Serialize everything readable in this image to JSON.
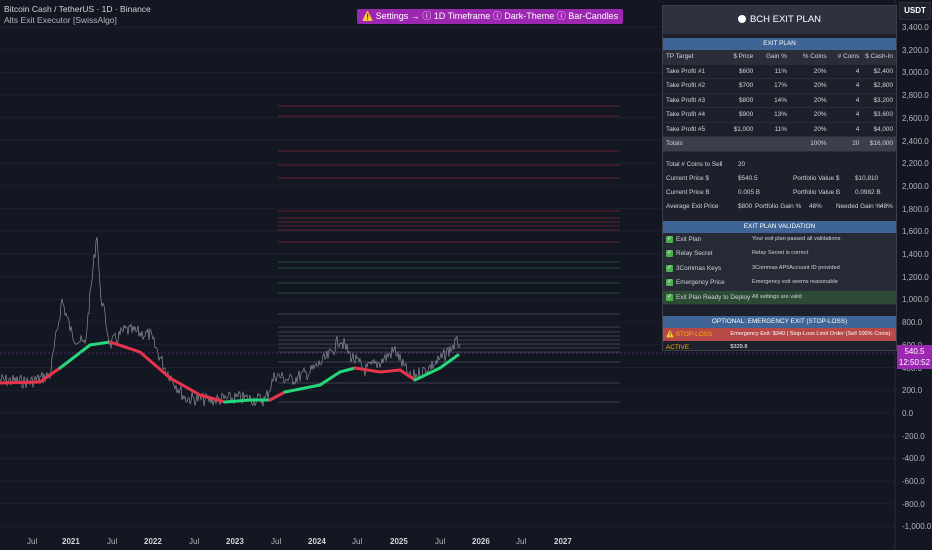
{
  "header": {
    "symbol_line": "Bitcoin Cash / TetherUS · 1D · Binance",
    "indicator_line": "Alts Exit Executor [SwissAlgo]",
    "banner": "⚠️ Settings → ⓘ 1D Timeframe ⓘ Dark-Theme ⓘ Bar-Candles",
    "currency_button": "USDT"
  },
  "price_axis": {
    "labels": [
      "3,400.0",
      "3,200.0",
      "3,000.0",
      "2,800.0",
      "2,600.0",
      "2,400.0",
      "2,200.0",
      "2,000.0",
      "1,800.0",
      "1,600.0",
      "1,400.0",
      "1,200.0",
      "1,000.0",
      "800.0",
      "600.0",
      "400.0",
      "200.0",
      "0.0",
      "-200.0",
      "-400.0",
      "-600.0",
      "-800.0",
      "-1,000.0"
    ],
    "current_price": "540.5",
    "countdown": "12:50:52"
  },
  "time_axis": {
    "labels": [
      {
        "t": "Jul",
        "bold": false
      },
      {
        "t": "2021",
        "bold": true
      },
      {
        "t": "Jul",
        "bold": false
      },
      {
        "t": "2022",
        "bold": true
      },
      {
        "t": "Jul",
        "bold": false
      },
      {
        "t": "2023",
        "bold": true
      },
      {
        "t": "Jul",
        "bold": false
      },
      {
        "t": "2024",
        "bold": true
      },
      {
        "t": "Jul",
        "bold": false
      },
      {
        "t": "2025",
        "bold": true
      },
      {
        "t": "Jul",
        "bold": false
      },
      {
        "t": "2026",
        "bold": true
      },
      {
        "t": "Jul",
        "bold": false
      },
      {
        "t": "2027",
        "bold": true
      }
    ]
  },
  "plan": {
    "title": "BCH EXIT PLAN",
    "section": "EXIT PLAN",
    "headers": [
      "TP Target",
      "$ Price",
      "Gain %",
      "% Coins",
      "# Coins",
      "$ Cash-In"
    ],
    "rows": [
      [
        "Take Profit #1",
        "$600",
        "11%",
        "20%",
        "4",
        "$2,400"
      ],
      [
        "Take Profit #2",
        "$700",
        "17%",
        "20%",
        "4",
        "$2,800"
      ],
      [
        "Take Profit #3",
        "$800",
        "14%",
        "20%",
        "4",
        "$3,200"
      ],
      [
        "Take Profit #4",
        "$900",
        "13%",
        "20%",
        "4",
        "$3,600"
      ],
      [
        "Take Profit #5",
        "$1,000",
        "11%",
        "20%",
        "4",
        "$4,000"
      ]
    ],
    "totals": [
      "Totals",
      "",
      "",
      "100%",
      "20",
      "$16,000"
    ],
    "summary": {
      "coins_label": "Total # Coins to Sell",
      "coins_value": "20",
      "cur_usd_label": "Current Price $",
      "cur_usd_value": "$540.5",
      "pv_usd_label": "Portfolio Value $",
      "pv_usd_value": "$10,810",
      "cur_btc_label": "Current Price B",
      "cur_btc_value": "0.005 B",
      "pv_btc_label": "Portfolio Value B",
      "pv_btc_value": "0.0982 B",
      "avg_label": "Average Exit Price",
      "avg_value": "$800",
      "pg_label": "Portfolio Gain %",
      "pg_value": "48%",
      "ng_label": "Needed Gain %",
      "ng_value": "48%"
    },
    "validation_section": "EXIT PLAN VALIDATION",
    "validation": [
      {
        "label": "Exit Plan",
        "msg": "Your exit plan passed all validations"
      },
      {
        "label": "Relay Secret",
        "msg": "Relay Secret is correct"
      },
      {
        "label": "3Commas Keys",
        "msg": "3Commas API/Account ID provided"
      },
      {
        "label": "Emergency Price",
        "msg": "Emergency exit seems reasonable"
      },
      {
        "label": "Exit Plan Ready to Deploy",
        "msg": "All settings are valid"
      }
    ],
    "optional_section": "OPTIONAL: EMERGENCY EXIT (STOP-LOSS)",
    "stop_label": "⚠️ STOP-LOSS ACTIVE",
    "stop_msg": "Emergency Exit: $340 | Stop-Loss Limit Order (Sell 100% Coins): $329.8"
  },
  "colors": {
    "background": "#131722",
    "bull": "#26d67a",
    "bear": "#e8344a",
    "panel_section": "#3f6597",
    "accent": "#9c27b0"
  }
}
